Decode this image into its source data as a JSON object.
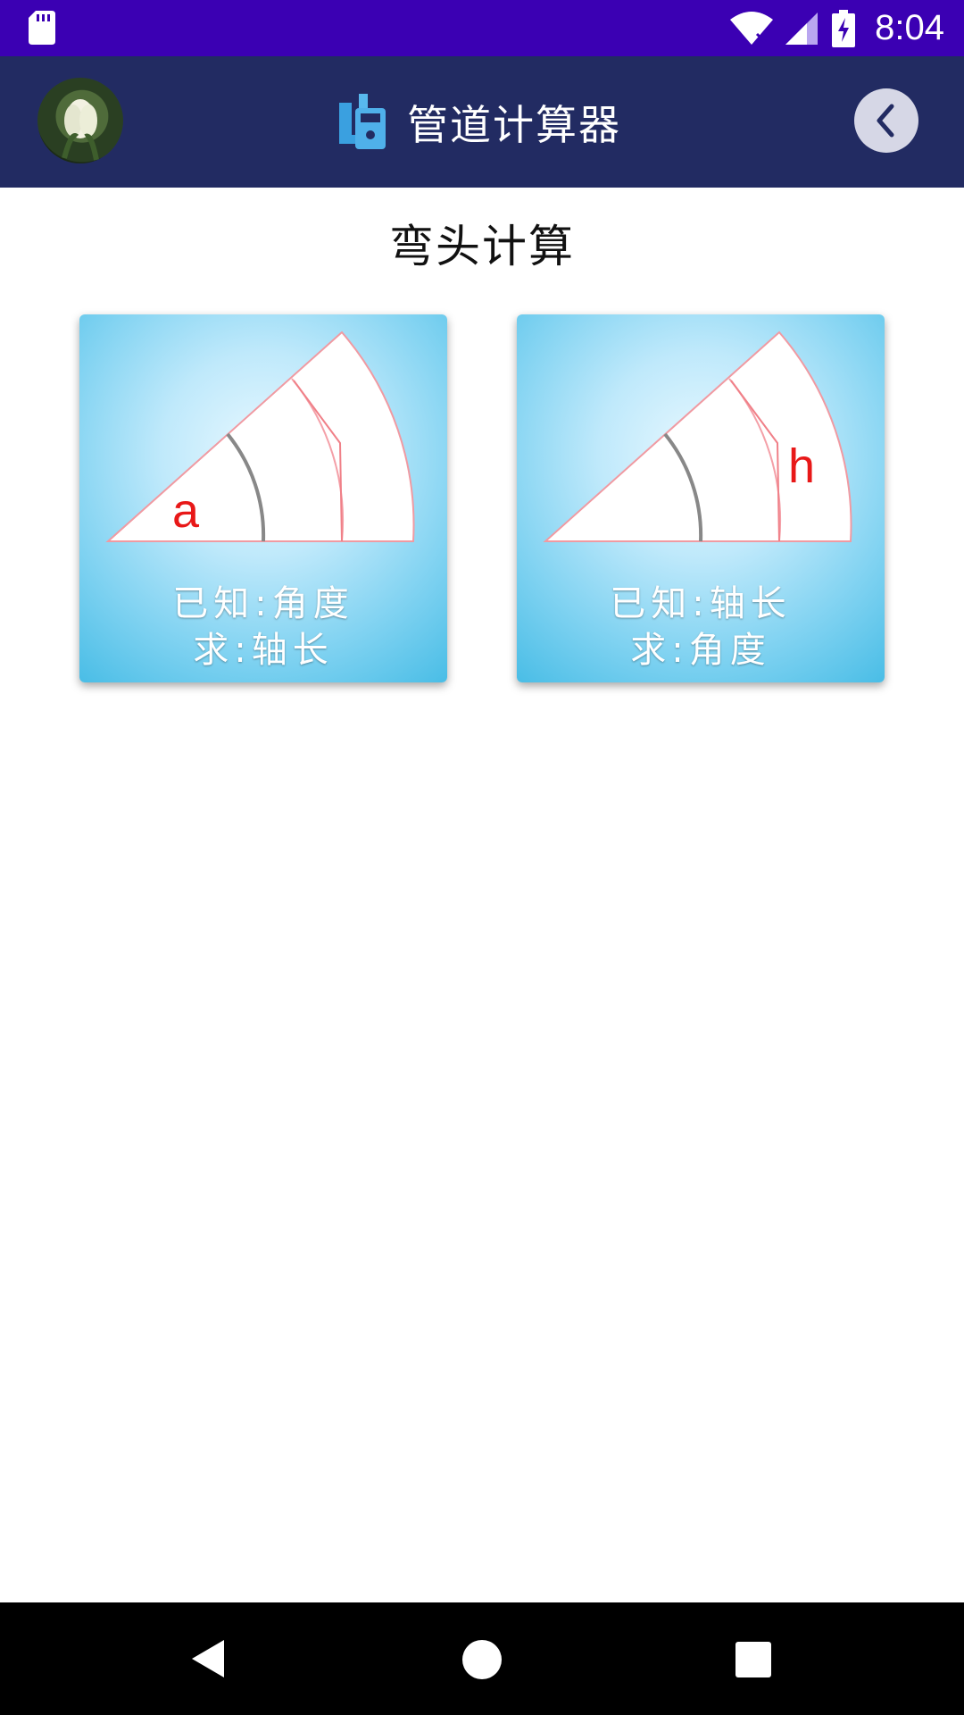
{
  "status_bar": {
    "time": "8:04",
    "icons": [
      "sd-card-icon",
      "wifi-icon",
      "signal-icon",
      "battery-charging-icon"
    ],
    "background": "#3b00b3"
  },
  "app_bar": {
    "title": "管道计算器",
    "app_icon": "pipe-calculator-icon",
    "back_icon": "chevron-left-icon",
    "background": "#222b62"
  },
  "main": {
    "heading": "弯头计算",
    "cards": [
      {
        "symbol": "a",
        "line1": "已知:角度",
        "line2": "求:轴长"
      },
      {
        "symbol": "h",
        "line1": "已知:轴长",
        "line2": "求:角度"
      }
    ]
  },
  "nav_bar": {
    "icons": [
      "nav-back-icon",
      "nav-home-icon",
      "nav-recents-icon"
    ]
  }
}
